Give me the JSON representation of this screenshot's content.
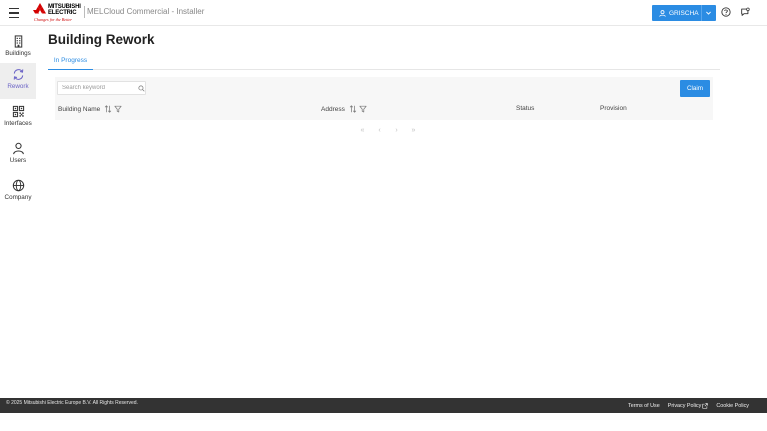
{
  "header": {
    "logo": {
      "brand_line1": "MITSUBISHI",
      "brand_line2": "ELECTRIC",
      "tagline": "Changes for the Better",
      "color": "#d40000"
    },
    "app_title": "MELCloud Commercial - Installer",
    "user": {
      "icon": "user-icon",
      "name": "GRISCHA",
      "dropdown_icon": "chevron-down-icon"
    },
    "help_icon": "help-circle-icon",
    "chat_icon": "chat-bubble-icon"
  },
  "sidebar": {
    "items": [
      {
        "label": "Buildings",
        "icon": "building-icon",
        "active": false
      },
      {
        "label": "Rework",
        "icon": "refresh-icon",
        "active": true
      },
      {
        "label": "Interfaces",
        "icon": "qr-code-icon",
        "active": false
      },
      {
        "label": "Users",
        "icon": "user-icon",
        "active": false
      },
      {
        "label": "Company",
        "icon": "globe-icon",
        "active": false
      }
    ]
  },
  "main": {
    "title": "Building Rework",
    "tabs": [
      {
        "label": "In Progress",
        "active": true
      }
    ],
    "search": {
      "placeholder": "Search keyword",
      "value": ""
    },
    "claim_label": "Claim",
    "table": {
      "columns": [
        {
          "label": "Building Name",
          "sortable": true,
          "filterable": true
        },
        {
          "label": "Address",
          "sortable": true,
          "filterable": true
        },
        {
          "label": "Status",
          "sortable": false,
          "filterable": false
        },
        {
          "label": "Provision",
          "sortable": false,
          "filterable": false
        }
      ],
      "rows": []
    },
    "pagination": {
      "first": "«",
      "prev": "‹",
      "next": "›",
      "last": "»"
    }
  },
  "footer": {
    "copyright": "© 2025 Mitsubishi Electric Europe B.V. All Rights Reserved.",
    "links": [
      {
        "label": "Terms of Use",
        "external": false
      },
      {
        "label": "Privacy Policy",
        "external": true
      },
      {
        "label": "Cookie Policy",
        "external": false
      }
    ]
  },
  "colors": {
    "accent": "#2b8ce3",
    "active_nav": "#6b63c6",
    "footer_bg": "#333333"
  }
}
